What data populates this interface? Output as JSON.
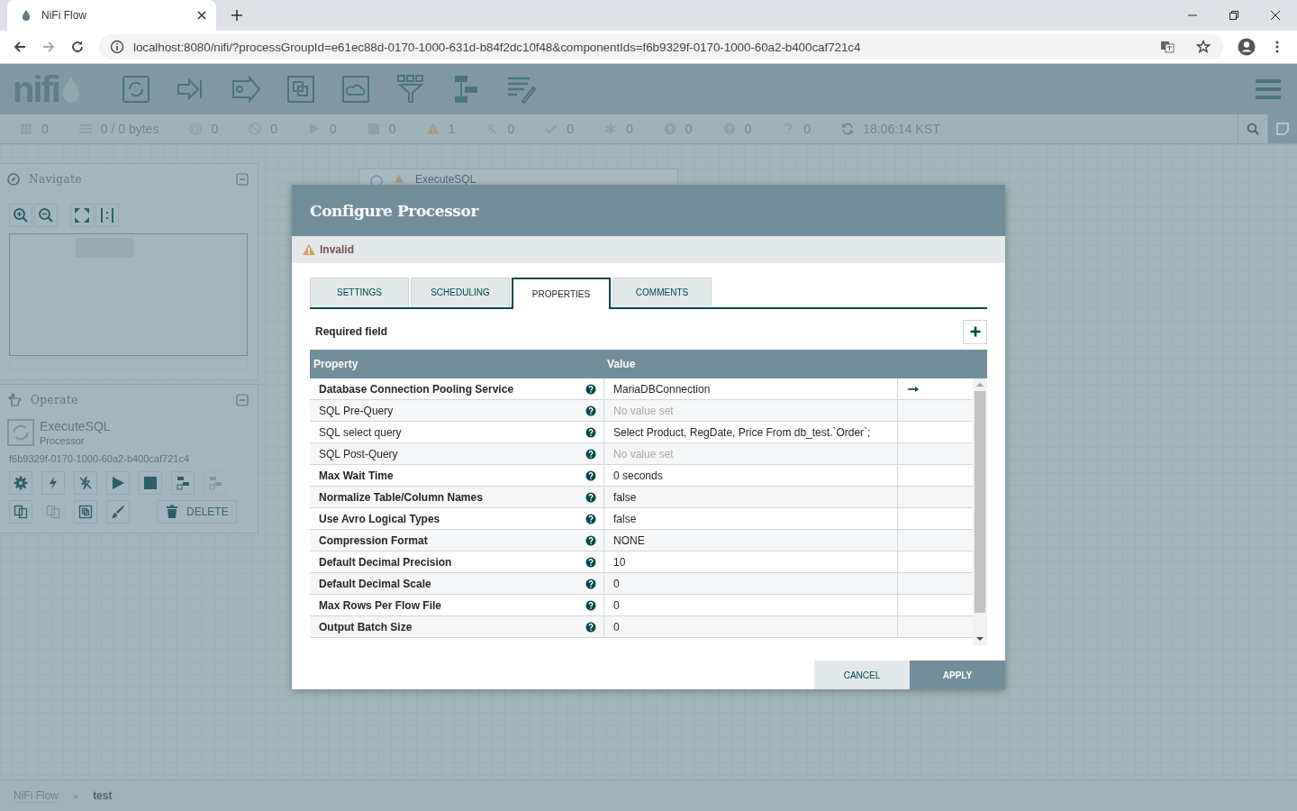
{
  "browser": {
    "tab_title": "NiFi Flow",
    "url": "localhost:8080/nifi/?processGroupId=e61ec88d-0170-1000-631d-b84f2dc10f48&componentIds=f6b9329f-0170-1000-60a2-b400caf721c4"
  },
  "header": {
    "logo": "nifi"
  },
  "status": {
    "items": [
      {
        "kind": "threads",
        "count": "0"
      },
      {
        "kind": "queued",
        "count": "0 / 0 bytes"
      },
      {
        "kind": "transmitting",
        "count": "0"
      },
      {
        "kind": "not-transmitting",
        "count": "0"
      },
      {
        "kind": "running",
        "count": "0"
      },
      {
        "kind": "stopped",
        "count": "0"
      },
      {
        "kind": "invalid",
        "count": "1"
      },
      {
        "kind": "disabled",
        "count": "0"
      },
      {
        "kind": "up-to-date",
        "count": "0"
      },
      {
        "kind": "modified",
        "count": "0"
      },
      {
        "kind": "stale",
        "count": "0"
      },
      {
        "kind": "error",
        "count": "0"
      },
      {
        "kind": "unknown",
        "count": "0"
      }
    ],
    "refreshed": "18:06:14 KST"
  },
  "navigate": {
    "title": "Navigate"
  },
  "operate": {
    "title": "Operate",
    "component_name": "ExecuteSQL",
    "component_type": "Processor",
    "component_id": "f6b9329f-0170-1000-60a2-b400caf721c4",
    "button_rows": [
      [
        {
          "kind": "configure",
          "disabled": false
        },
        {
          "kind": "enable",
          "disabled": false
        },
        {
          "kind": "disable",
          "disabled": false
        },
        {
          "kind": "start",
          "disabled": false
        },
        {
          "kind": "stop",
          "disabled": false
        },
        {
          "kind": "template",
          "disabled": false
        },
        {
          "kind": "upload",
          "disabled": true
        }
      ],
      [
        {
          "kind": "copy",
          "disabled": false
        },
        {
          "kind": "paste",
          "disabled": true
        },
        {
          "kind": "group",
          "disabled": false
        },
        {
          "kind": "color",
          "disabled": false
        },
        {
          "kind": "delete",
          "label": "DELETE",
          "disabled": false
        }
      ]
    ]
  },
  "canvas": {
    "processor_name": "ExecuteSQL"
  },
  "dialog": {
    "title": "Configure Processor",
    "status": "Invalid",
    "tabs": [
      {
        "label": "SETTINGS",
        "selected": false
      },
      {
        "label": "SCHEDULING",
        "selected": false
      },
      {
        "label": "PROPERTIES",
        "selected": true
      },
      {
        "label": "COMMENTS",
        "selected": false
      }
    ],
    "required_label": "Required field",
    "columns": [
      "Property",
      "Value"
    ],
    "properties": [
      {
        "name": "Database Connection Pooling Service",
        "value": "MariaDBConnection",
        "required": true,
        "value_set": true,
        "goto": true
      },
      {
        "name": "SQL Pre-Query",
        "value": "No value set",
        "required": false,
        "value_set": false,
        "goto": false
      },
      {
        "name": "SQL select query",
        "value": "Select Product, RegDate, Price From db_test.`Order`;",
        "required": false,
        "value_set": true,
        "goto": false
      },
      {
        "name": "SQL Post-Query",
        "value": "No value set",
        "required": false,
        "value_set": false,
        "goto": false
      },
      {
        "name": "Max Wait Time",
        "value": "0 seconds",
        "required": true,
        "value_set": true,
        "goto": false
      },
      {
        "name": "Normalize Table/Column Names",
        "value": "false",
        "required": true,
        "value_set": true,
        "goto": false
      },
      {
        "name": "Use Avro Logical Types",
        "value": "false",
        "required": true,
        "value_set": true,
        "goto": false
      },
      {
        "name": "Compression Format",
        "value": "NONE",
        "required": true,
        "value_set": true,
        "goto": false
      },
      {
        "name": "Default Decimal Precision",
        "value": "10",
        "required": true,
        "value_set": true,
        "goto": false
      },
      {
        "name": "Default Decimal Scale",
        "value": "0",
        "required": true,
        "value_set": true,
        "goto": false
      },
      {
        "name": "Max Rows Per Flow File",
        "value": "0",
        "required": true,
        "value_set": true,
        "goto": false
      },
      {
        "name": "Output Batch Size",
        "value": "0",
        "required": true,
        "value_set": true,
        "goto": false
      }
    ],
    "buttons": [
      {
        "label": "CANCEL",
        "kind": "secondary"
      },
      {
        "label": "APPLY",
        "kind": "primary"
      }
    ]
  },
  "breadcrumbs": {
    "separator": "»",
    "items": [
      {
        "label": "NiFi Flow",
        "current": false
      },
      {
        "label": "test",
        "current": true
      }
    ]
  }
}
